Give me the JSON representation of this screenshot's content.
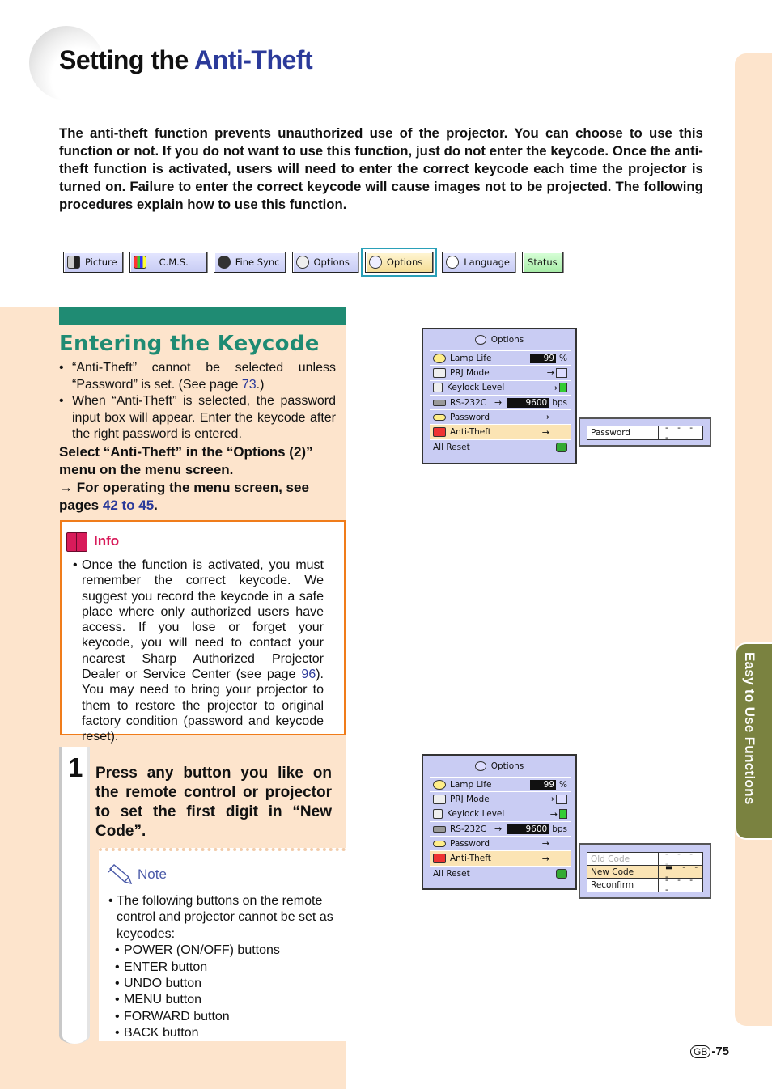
{
  "page": {
    "title_prefix": "Setting the ",
    "title_accent": "Anti-Theft",
    "intro": "The anti-theft function prevents unauthorized use of the projector. You can choose to use this function or not. If you do not want to use this function, just do not enter the keycode. Once the anti-theft function is activated, users will need to enter the correct keycode each time the projector is turned on. Failure to enter the correct keycode will cause images not to be projected. The following procedures explain how to use this function.",
    "page_number_badge": "GB",
    "page_number": "-75",
    "side_tab_label": "Easy to Use Functions"
  },
  "menu_tabs": [
    {
      "label": "Picture",
      "icon": "picture-icon"
    },
    {
      "label": "C.M.S.",
      "icon": "cms-icon"
    },
    {
      "label": "Fine Sync",
      "icon": "fine-sync-icon"
    },
    {
      "label": "Options",
      "icon": "options1-icon"
    },
    {
      "label": "Options",
      "icon": "options2-icon",
      "active": true
    },
    {
      "label": "Language",
      "icon": "language-icon"
    },
    {
      "label": "Status",
      "icon": ""
    }
  ],
  "section": {
    "title": "Entering the Keycode",
    "bullets": [
      {
        "pre": "“Anti-Theft” cannot be selected unless “Password” is set. (See page ",
        "link": "73",
        "post": ".)"
      },
      {
        "pre": "When “Anti-Theft” is selected, the password input box will appear. Enter the keycode after the right password is entered.",
        "link": "",
        "post": ""
      }
    ],
    "instruction": "Select “Anti-Theft” in the “Options (2)” menu on the menu screen.",
    "see_pre": "→ For operating the menu screen, see pages ",
    "see_link": "42 to 45",
    "see_post": "."
  },
  "info": {
    "label": "Info",
    "text_pre": "Once the function is activated, you must remember the correct keycode. We suggest you record the keycode in a safe place where only authorized users have access. If you lose or forget your keycode, you will need to contact your nearest Sharp Authorized Projector Dealer or Service Center (see page ",
    "text_link": "96",
    "text_post": "). You may need to bring your projector to them to restore the projector to original factory condition (password and keycode reset)."
  },
  "step1": {
    "number": "1",
    "text": "Press any button you like on the remote control or projector to set the first digit in “New Code”."
  },
  "note": {
    "label": "Note",
    "intro": "The following buttons on the remote control and projector cannot be set as keycodes:",
    "items": [
      "POWER (ON/OFF) buttons",
      "ENTER button",
      "UNDO button",
      "MENU button",
      "FORWARD button",
      "BACK button"
    ]
  },
  "osd_menu": {
    "title": "Options",
    "rows": [
      {
        "label": "Lamp Life",
        "value": "99",
        "unit": "%"
      },
      {
        "label": "PRJ Mode",
        "value": "→"
      },
      {
        "label": "Keylock Level",
        "value": "→"
      },
      {
        "label": "RS-232C",
        "value": "9600",
        "unit": "bps"
      },
      {
        "label": "Password",
        "value": "→"
      },
      {
        "label": "Anti-Theft",
        "value": "→",
        "selected": true
      },
      {
        "label": "All Reset",
        "value": ""
      }
    ]
  },
  "popup1": {
    "rows": [
      {
        "label": "Password",
        "value": "- - - -"
      }
    ]
  },
  "popup2": {
    "rows": [
      {
        "label": "Old Code",
        "value": "- - - -",
        "state": "disabled"
      },
      {
        "label": "New Code",
        "value": "▬ - - -",
        "state": "selected"
      },
      {
        "label": "Reconfirm",
        "value": "- - - -",
        "state": "normal"
      }
    ]
  }
}
